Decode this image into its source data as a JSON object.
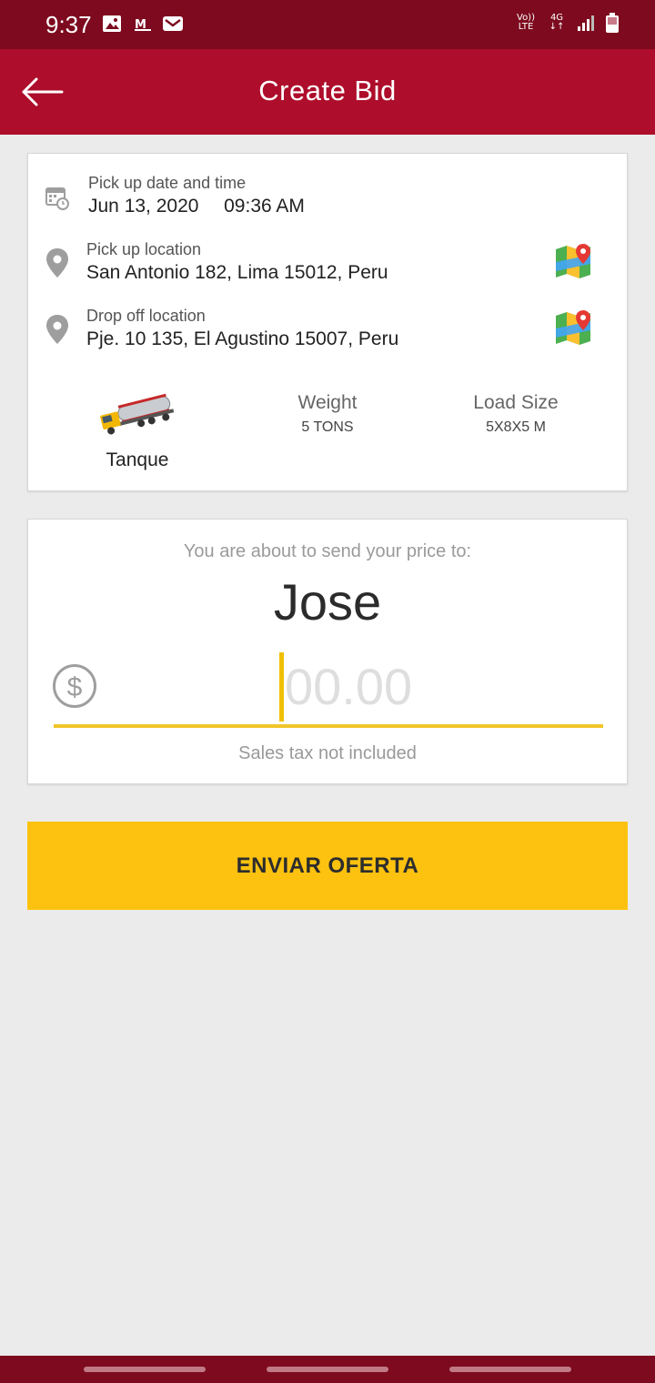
{
  "status_bar": {
    "time": "9:37",
    "left_icons": [
      "image-icon",
      "gmail-icon",
      "mail-icon"
    ],
    "volte": "Vo)) LTE",
    "network": "4G"
  },
  "app_bar": {
    "title": "Create Bid",
    "back_icon": "arrow-left-icon"
  },
  "trip": {
    "pickup_datetime": {
      "label": "Pick up date and time",
      "date": "Jun 13, 2020",
      "time": "09:36 AM"
    },
    "pickup_location": {
      "label": "Pick up location",
      "address": "San Antonio 182, Lima 15012, Peru"
    },
    "dropoff_location": {
      "label": "Drop off location",
      "address": "Pje. 10 135, El Agustino 15007, Peru"
    },
    "vehicle": {
      "type": "Tanque"
    },
    "weight": {
      "title": "Weight",
      "value": "5 TONS"
    },
    "load_size": {
      "title": "Load Size",
      "value": "5X8X5 M"
    }
  },
  "bid": {
    "intro": "You are about to send your price to:",
    "recipient": "Jose",
    "price_value": "",
    "price_placeholder": "00.00",
    "tax_note": "Sales tax not included"
  },
  "actions": {
    "submit_label": "ENVIAR OFERTA"
  },
  "colors": {
    "status_bar": "#7d0a1e",
    "app_bar": "#ae0e2b",
    "accent_yellow": "#fdc20f",
    "background": "#ebebeb"
  }
}
